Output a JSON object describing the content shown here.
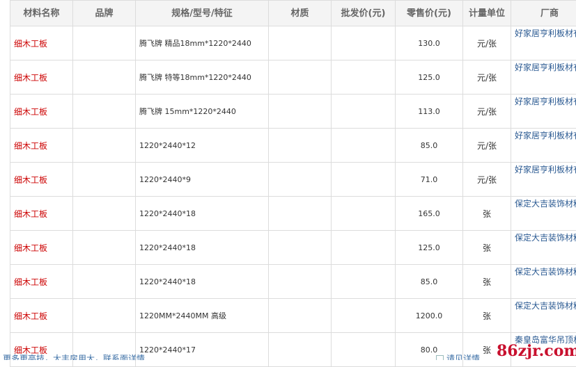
{
  "headers": [
    "材料名称",
    "品牌",
    "规格/型号/特征",
    "材质",
    "批发价(元)",
    "零售价(元)",
    "计量单位",
    "厂商"
  ],
  "rows": [
    {
      "name": "细木工板",
      "brand": "",
      "spec": "腾飞牌 精品18mm*1220*2440",
      "material": "",
      "wholesale": "",
      "retail": "130.0",
      "unit": "元/张",
      "vendor": "好家居亨利板材有限公司庄配送中心"
    },
    {
      "name": "细木工板",
      "brand": "",
      "spec": "腾飞牌 特等18mm*1220*2440",
      "material": "",
      "wholesale": "",
      "retail": "125.0",
      "unit": "元/张",
      "vendor": "好家居亨利板材有限公司庄配送中心"
    },
    {
      "name": "细木工板",
      "brand": "",
      "spec": "腾飞牌 15mm*1220*2440",
      "material": "",
      "wholesale": "",
      "retail": "113.0",
      "unit": "元/张",
      "vendor": "好家居亨利板材有限公司庄配送中心"
    },
    {
      "name": "细木工板",
      "brand": "",
      "spec": "1220*2440*12",
      "material": "",
      "wholesale": "",
      "retail": "85.0",
      "unit": "元/张",
      "vendor": "好家居亨利板材有限公司庄配送中心"
    },
    {
      "name": "细木工板",
      "brand": "",
      "spec": "1220*2440*9",
      "material": "",
      "wholesale": "",
      "retail": "71.0",
      "unit": "元/张",
      "vendor": "好家居亨利板材有限公司庄配送中心"
    },
    {
      "name": "细木工板",
      "brand": "",
      "spec": "1220*2440*18",
      "material": "",
      "wholesale": "",
      "retail": "165.0",
      "unit": "张",
      "vendor": "保定大吉装饰材料有限公司"
    },
    {
      "name": "细木工板",
      "brand": "",
      "spec": "1220*2440*18",
      "material": "",
      "wholesale": "",
      "retail": "125.0",
      "unit": "张",
      "vendor": "保定大吉装饰材料有限公司"
    },
    {
      "name": "细木工板",
      "brand": "",
      "spec": "1220*2440*18",
      "material": "",
      "wholesale": "",
      "retail": "85.0",
      "unit": "张",
      "vendor": "保定大吉装饰材料有限公司"
    },
    {
      "name": "细木工板",
      "brand": "",
      "spec": "1220MM*2440MM 高级",
      "material": "",
      "wholesale": "",
      "retail": "1200.0",
      "unit": "张",
      "vendor": "保定大吉装饰材料有限公司"
    },
    {
      "name": "细木工板",
      "brand": "",
      "spec": "1220*2440*17",
      "material": "",
      "wholesale": "",
      "retail": "80.0",
      "unit": "张",
      "vendor": "秦皇岛富华吊顶材料"
    }
  ],
  "footer": {
    "left_text": "更多更高技，大丰房用大，联系面详情",
    "mid_text": "请见详情"
  },
  "watermark": "86zjr.com"
}
